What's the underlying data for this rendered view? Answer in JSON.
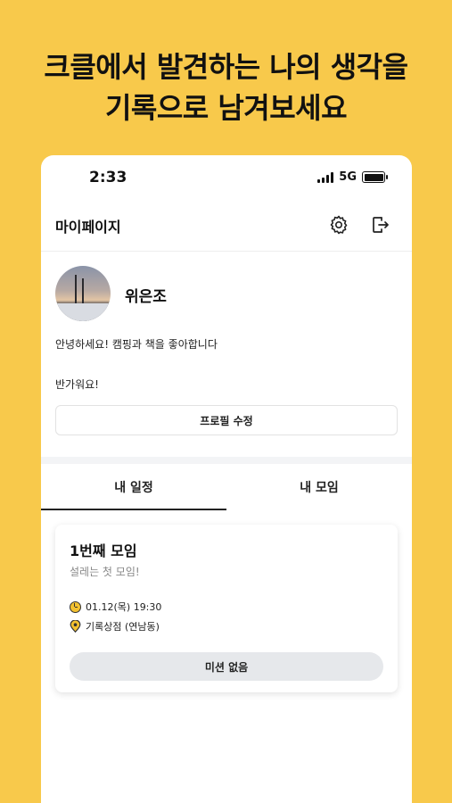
{
  "headline": {
    "line1": "크클에서 발견하는 나의 생각을",
    "line2": "기록으로 남겨보세요"
  },
  "status_bar": {
    "time": "2:33",
    "network": "5G"
  },
  "app_bar": {
    "title": "마이페이지",
    "settings_icon": "gear-icon",
    "logout_icon": "logout-icon"
  },
  "profile": {
    "name": "위은조",
    "bio_line1": "안녕하세요! 캠핑과 책을 좋아합니다",
    "bio_line2": "반가워요!",
    "edit_button": "프로필 수정"
  },
  "tabs": [
    {
      "label": "내 일정",
      "selected": true
    },
    {
      "label": "내 모임",
      "selected": false
    }
  ],
  "schedule_card": {
    "title": "1번째 모임",
    "subtitle": "설레는 첫 모임!",
    "datetime": "01.12(목) 19:30",
    "location": "기록상점 (연남동)",
    "mission_button": "미션 없음"
  },
  "colors": {
    "background": "#F8C94B",
    "accent": "#F3C130",
    "button_gray": "#E6E8EB"
  }
}
